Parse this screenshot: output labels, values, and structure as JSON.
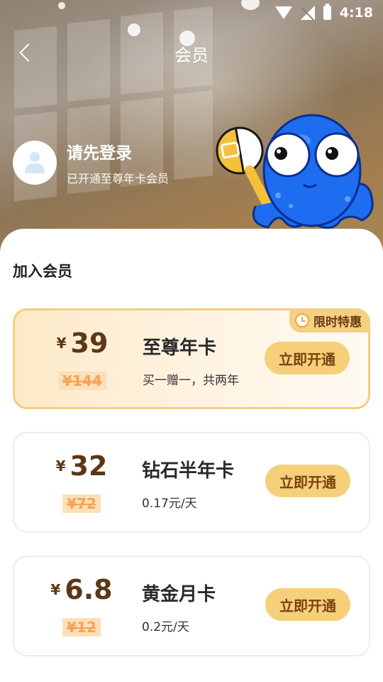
{
  "status_bar": {
    "time": "4:18"
  },
  "header": {
    "title": "会员"
  },
  "user": {
    "name": "请先登录",
    "subtitle": "已开通至尊年卡会员"
  },
  "section": {
    "title": "加入会员"
  },
  "plans": [
    {
      "currency": "¥",
      "price": "39",
      "original_price": "¥144",
      "name": "至尊年卡",
      "desc": "买一赠一，共两年",
      "button": "立即开通",
      "badge": "限时特惠"
    },
    {
      "currency": "¥",
      "price": "32",
      "original_price": "¥72",
      "name": "钻石半年卡",
      "desc": "0.17元/天",
      "button": "立即开通"
    },
    {
      "currency": "¥",
      "price": "6.8",
      "original_price": "¥12",
      "name": "黄金月卡",
      "desc": "0.2元/天",
      "button": "立即开通"
    }
  ],
  "colors": {
    "accent": "#f5cf7a",
    "price_text": "#5c3716",
    "featured_border": "#f3cc86",
    "mascot_blue": "#1e6cf0"
  },
  "icons": {
    "back": "chevron-left-icon",
    "avatar": "user-avatar-icon",
    "badge": "clock-icon",
    "wifi": "wifi-icon",
    "signal": "signal-off-icon",
    "battery": "battery-charging-icon"
  }
}
